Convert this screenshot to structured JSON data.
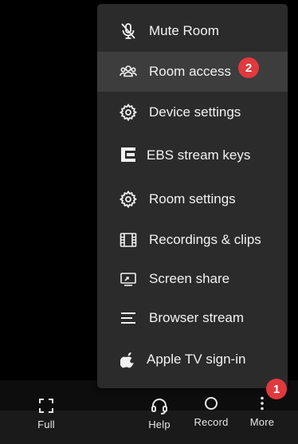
{
  "menu": {
    "items": [
      {
        "label": "Mute Room",
        "icon": "mic-off-icon"
      },
      {
        "label": "Room access",
        "icon": "people-icon"
      },
      {
        "label": "Device settings",
        "icon": "gear-icon"
      },
      {
        "label": "EBS stream keys",
        "icon": "ebs-logo-icon"
      },
      {
        "label": "Room settings",
        "icon": "gear-icon"
      },
      {
        "label": "Recordings & clips",
        "icon": "film-icon"
      },
      {
        "label": "Screen share",
        "icon": "screen-share-icon"
      },
      {
        "label": "Browser stream",
        "icon": "lines-icon"
      },
      {
        "label": "Apple TV sign-in",
        "icon": "apple-icon"
      }
    ],
    "active_index": 1
  },
  "badges": {
    "room_access": "2",
    "more": "1"
  },
  "toolbar": {
    "full_label": "Full",
    "help_label": "Help",
    "record_label": "Record",
    "more_label": "More"
  },
  "colors": {
    "menu_bg": "#2b2b2b",
    "active_bg": "#3d3d3d",
    "badge": "#e0393e"
  }
}
